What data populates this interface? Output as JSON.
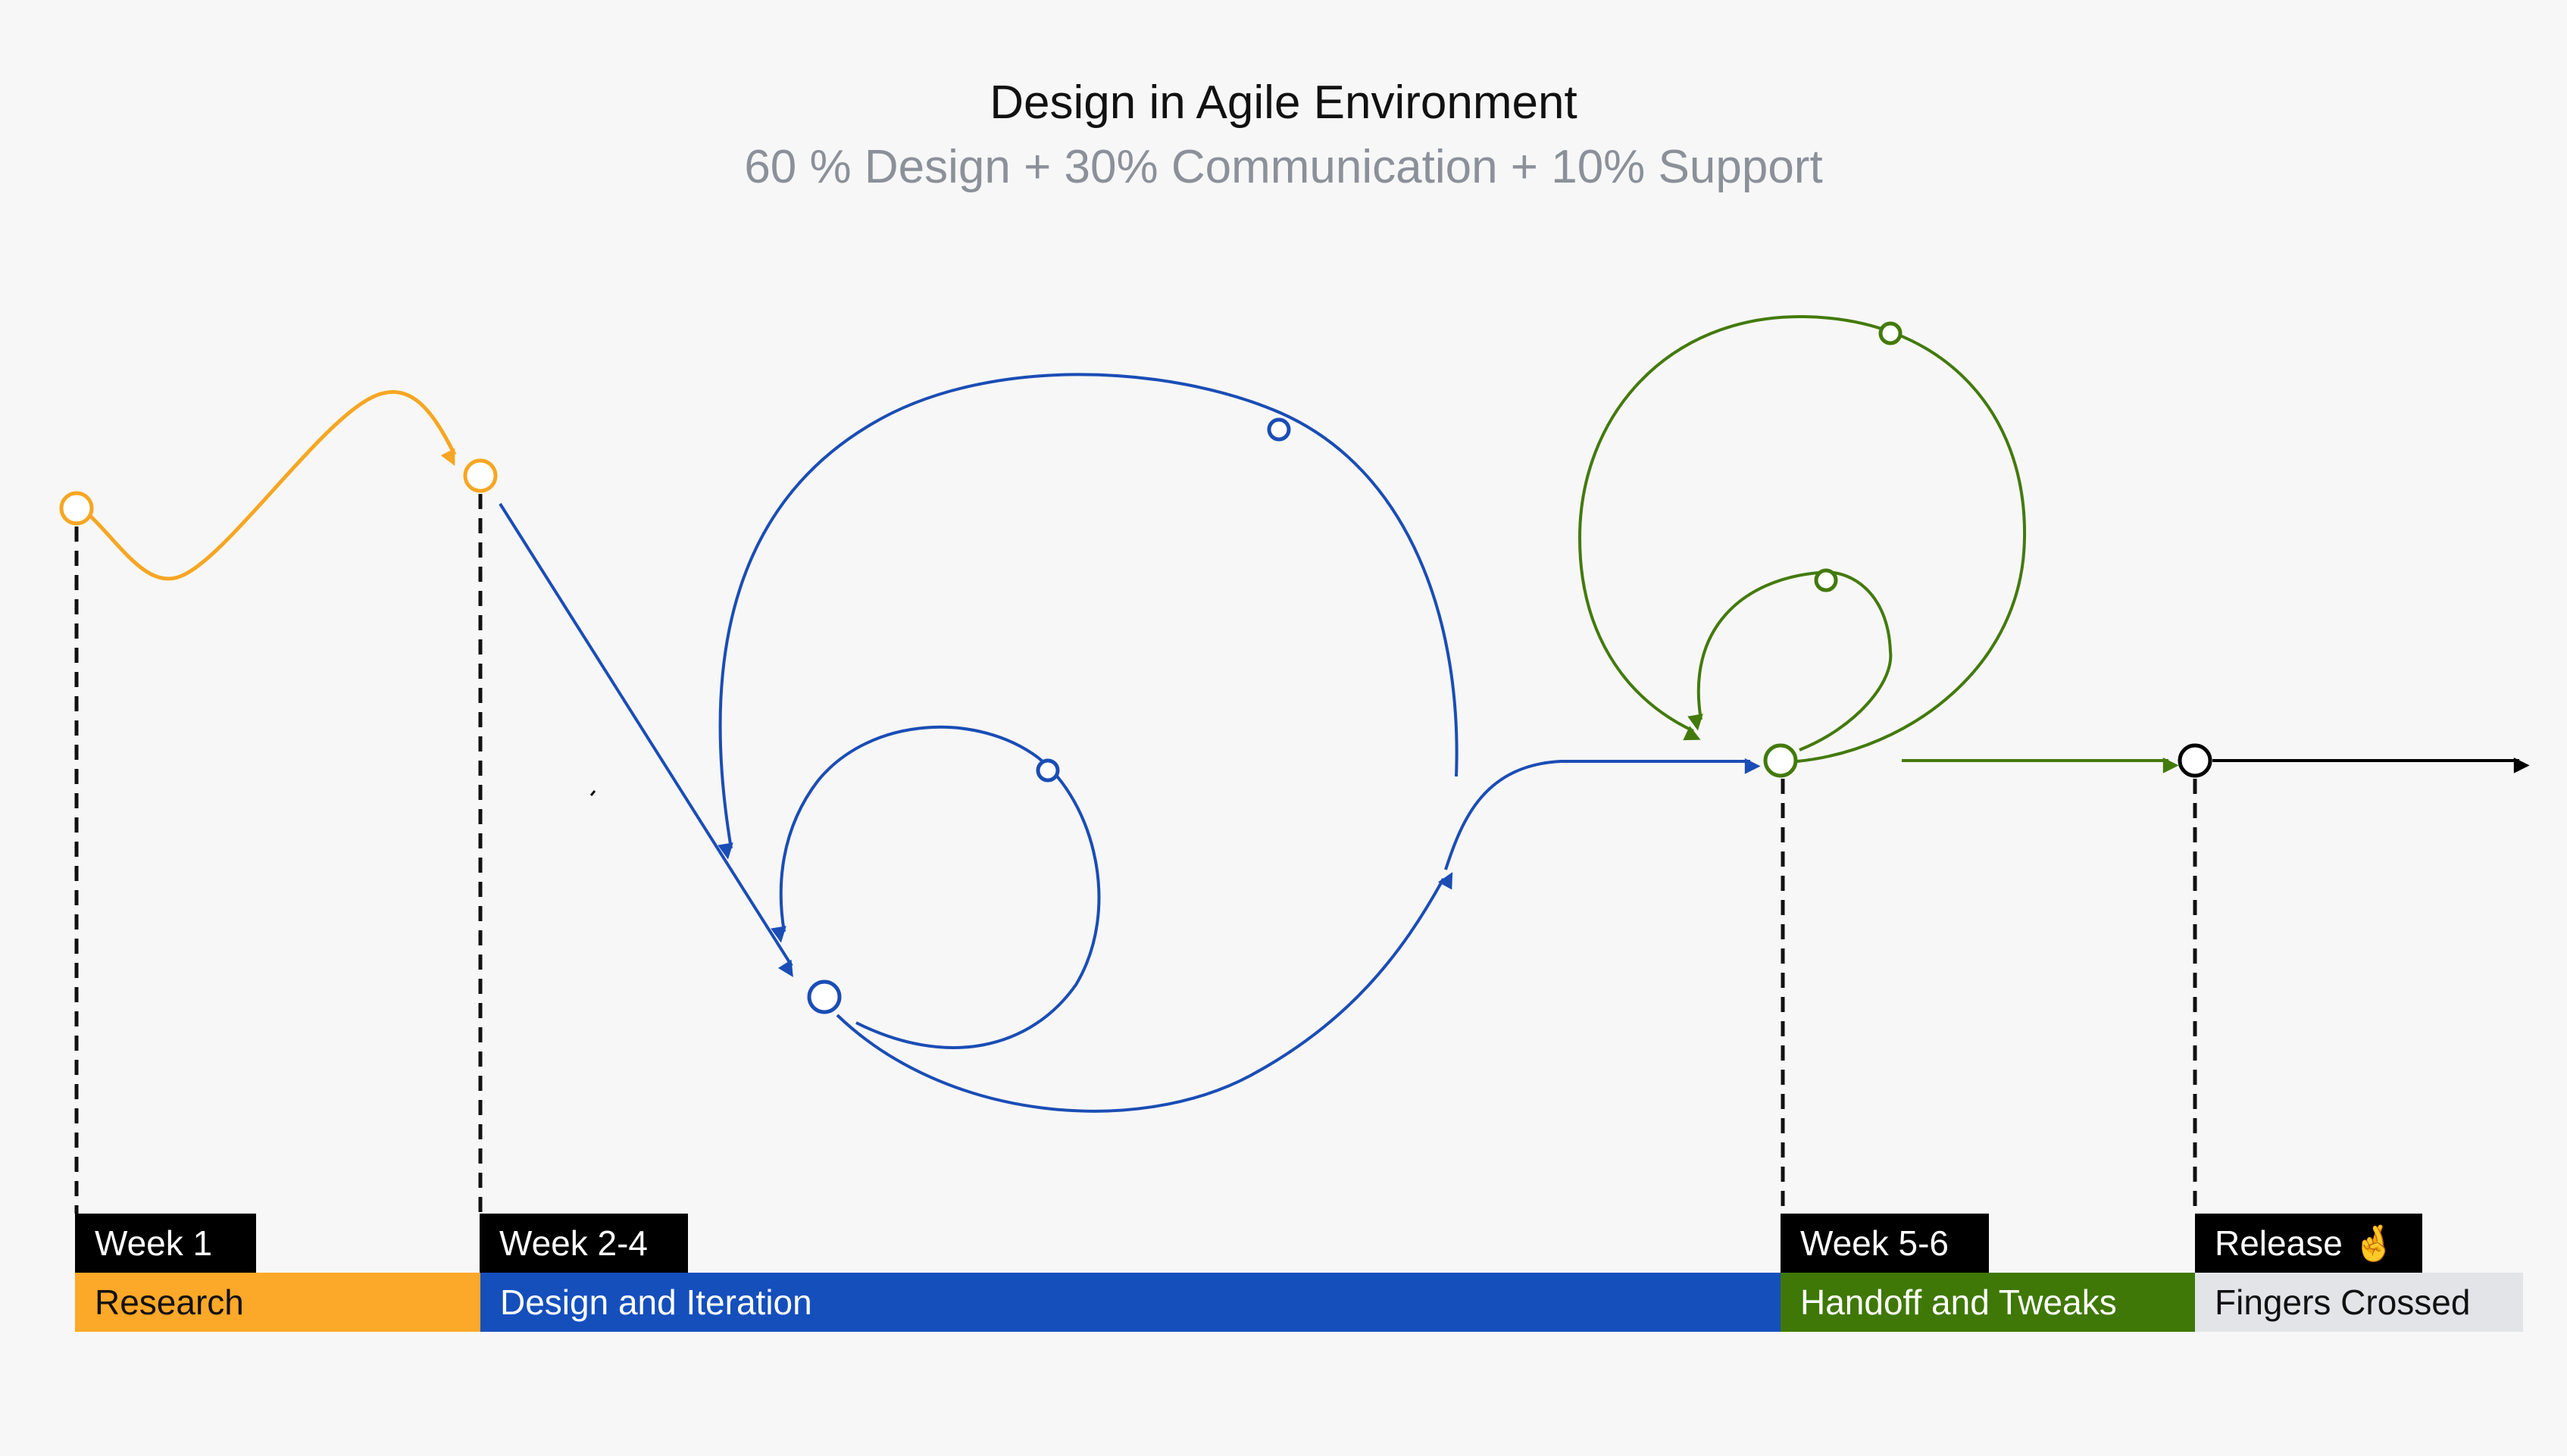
{
  "header": {
    "title": "Design in Agile Environment",
    "subtitle": "60 % Design + 30% Communication + 10% Support"
  },
  "phases": [
    {
      "week": "Week 1",
      "name": "Research",
      "color": "#fca828",
      "text_color": "#111111"
    },
    {
      "week": "Week 2-4",
      "name": "Design and Iteration",
      "color": "#154fbc",
      "text_color": "#ffffff"
    },
    {
      "week": "Week 5-6",
      "name": "Handoff and Tweaks",
      "color": "#3f7806",
      "text_color": "#ffffff"
    },
    {
      "week": "Release 🤞",
      "name": "Fingers Crossed",
      "color": "#e3e4e8",
      "text_color": "#111111"
    }
  ],
  "colors": {
    "research": "#f6a623",
    "design": "#1a4db5",
    "handoff": "#437a0c",
    "release": "#000000"
  }
}
